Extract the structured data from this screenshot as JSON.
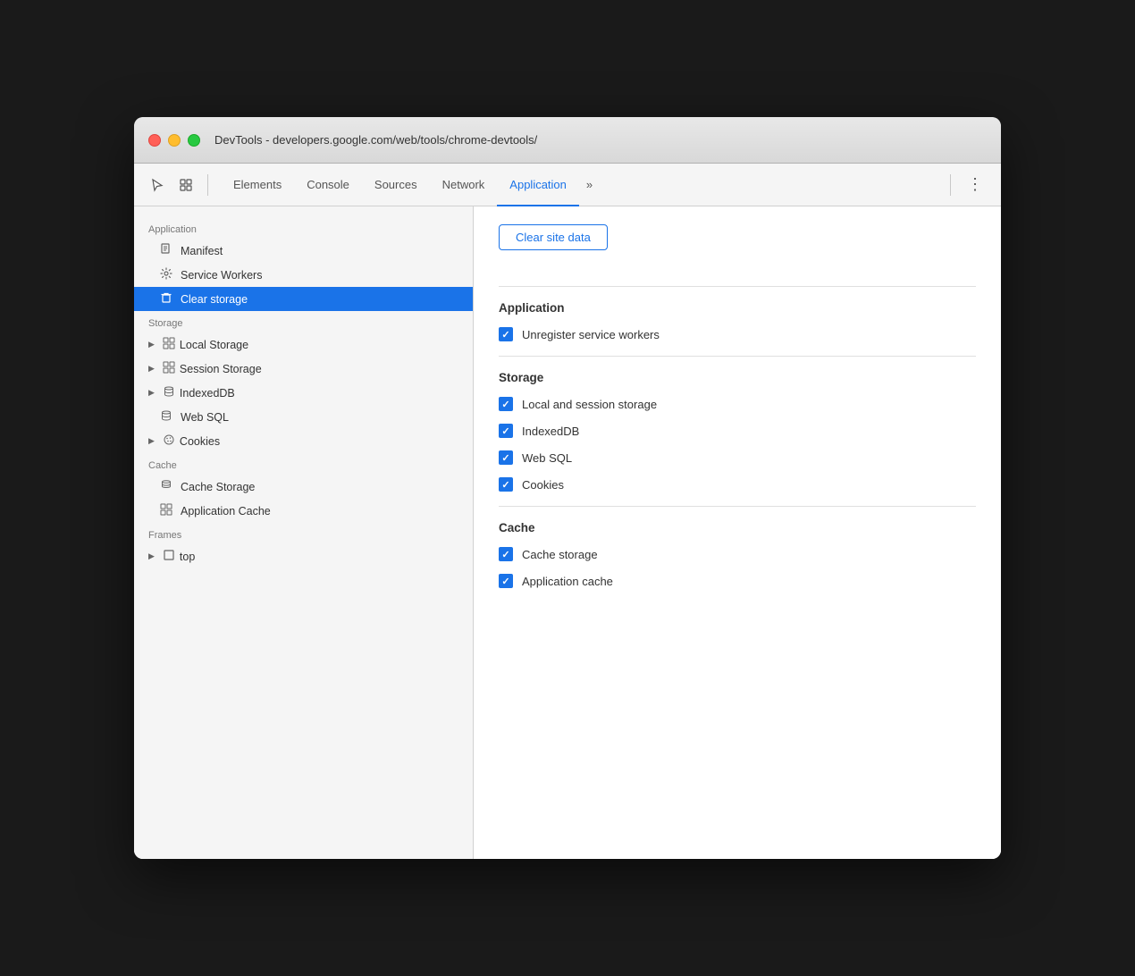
{
  "window": {
    "title": "DevTools - developers.google.com/web/tools/chrome-devtools/"
  },
  "toolbar": {
    "tabs": [
      {
        "id": "elements",
        "label": "Elements",
        "active": false
      },
      {
        "id": "console",
        "label": "Console",
        "active": false
      },
      {
        "id": "sources",
        "label": "Sources",
        "active": false
      },
      {
        "id": "network",
        "label": "Network",
        "active": false
      },
      {
        "id": "application",
        "label": "Application",
        "active": true
      }
    ],
    "more_label": "»"
  },
  "sidebar": {
    "application_section": "Application",
    "items_app": [
      {
        "id": "manifest",
        "label": "Manifest",
        "icon": "doc",
        "active": false
      },
      {
        "id": "service-workers",
        "label": "Service Workers",
        "icon": "gear",
        "active": false
      },
      {
        "id": "clear-storage",
        "label": "Clear storage",
        "icon": "trash",
        "active": true
      }
    ],
    "storage_section": "Storage",
    "items_storage": [
      {
        "id": "local-storage",
        "label": "Local Storage",
        "icon": "grid",
        "arrow": true
      },
      {
        "id": "session-storage",
        "label": "Session Storage",
        "icon": "grid",
        "arrow": true
      },
      {
        "id": "indexeddb",
        "label": "IndexedDB",
        "icon": "db",
        "arrow": true
      },
      {
        "id": "web-sql",
        "label": "Web SQL",
        "icon": "db",
        "arrow": false
      },
      {
        "id": "cookies",
        "label": "Cookies",
        "icon": "cookies",
        "arrow": true
      }
    ],
    "cache_section": "Cache",
    "items_cache": [
      {
        "id": "cache-storage",
        "label": "Cache Storage",
        "icon": "layers"
      },
      {
        "id": "app-cache",
        "label": "Application Cache",
        "icon": "grid"
      }
    ],
    "frames_section": "Frames",
    "items_frames": [
      {
        "id": "top",
        "label": "top",
        "icon": "frame",
        "arrow": true
      }
    ]
  },
  "content": {
    "clear_btn": "Clear site data",
    "application_section": "Application",
    "storage_section": "Storage",
    "cache_section": "Cache",
    "checkboxes": {
      "unregister_service_workers": "Unregister service workers",
      "local_session_storage": "Local and session storage",
      "indexeddb": "IndexedDB",
      "web_sql": "Web SQL",
      "cookies": "Cookies",
      "cache_storage": "Cache storage",
      "application_cache": "Application cache"
    }
  }
}
